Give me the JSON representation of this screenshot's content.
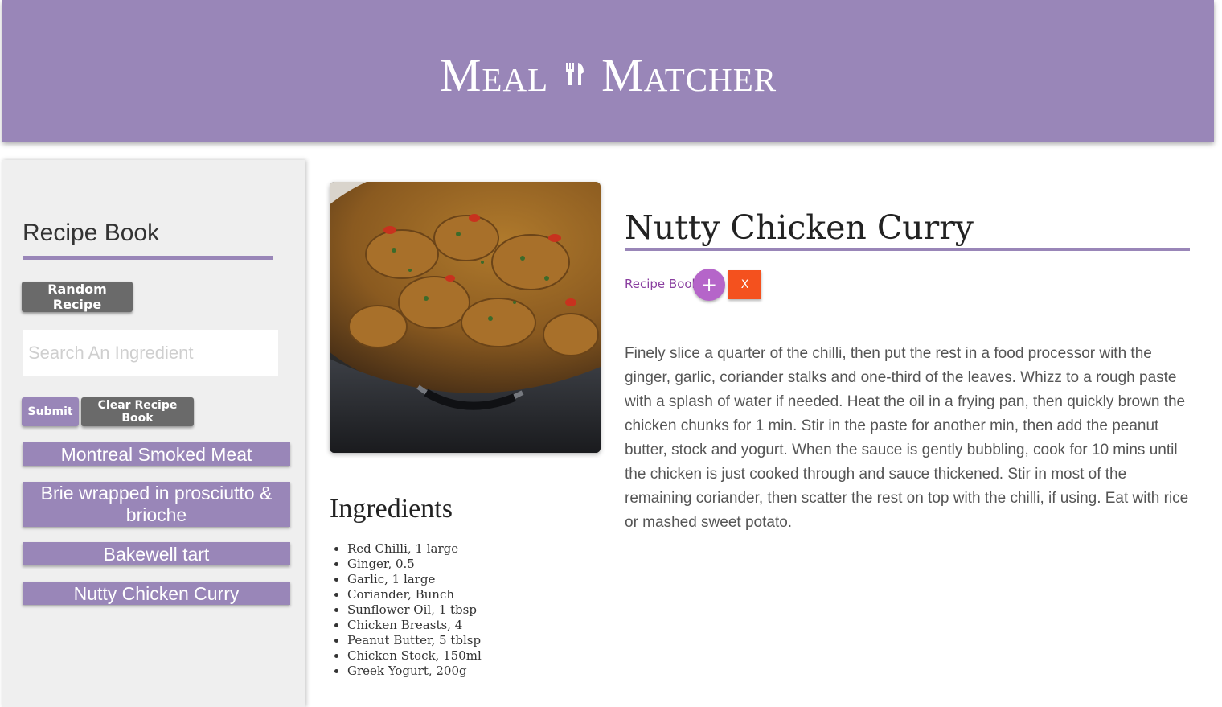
{
  "header": {
    "title_left": "Meal",
    "title_right": "Matcher",
    "logo_icon": "fork-knife-icon"
  },
  "sidebar": {
    "title": "Recipe Book",
    "random_label": "Random Recipe",
    "search_placeholder": "Search An Ingredient",
    "search_value": "",
    "submit_label": "Submit",
    "clear_label": "Clear Recipe Book",
    "recipes": [
      "Montreal Smoked Meat",
      "Brie wrapped in prosciutto & brioche",
      "Bakewell tart",
      "Nutty Chicken Curry"
    ]
  },
  "recipe": {
    "title": "Nutty Chicken Curry",
    "recipe_book_label": "Recipe Book",
    "add_label": "+",
    "remove_label": "X",
    "ingredients_title": "Ingredients",
    "ingredients": [
      "Red Chilli, 1 large",
      "Ginger, 0.5",
      "Garlic, 1 large",
      "Coriander, Bunch",
      "Sunflower Oil, 1 tbsp",
      "Chicken Breasts, 4",
      "Peanut Butter, 5 tblsp",
      "Chicken Stock, 150ml",
      "Greek Yogurt, 200g"
    ],
    "method": "Finely slice a quarter of the chilli, then put the rest in a food processor with the ginger, garlic, coriander stalks and one-third of the leaves. Whizz to a rough paste with a splash of water if needed. Heat the oil in a frying pan, then quickly brown the chicken chunks for 1 min. Stir in the paste for another min, then add the peanut butter, stock and yogurt. When the sauce is gently bubbling, cook for 10 mins until the chicken is just cooked through and sauce thickened. Stir in most of the remaining coriander, then scatter the rest on top with the chilli, if using. Eat with rice or mashed sweet potato."
  },
  "colors": {
    "accent": "#9986b8",
    "add_button": "#b565c9",
    "remove_button": "#f4511e",
    "dark_button": "#6a6a6a"
  }
}
